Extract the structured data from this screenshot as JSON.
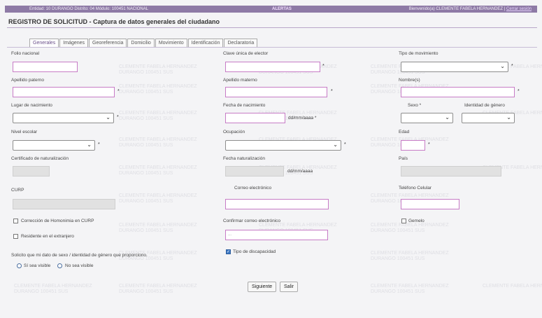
{
  "header": {
    "entity": "Entidad: 10 DURANGO Distrito: 04 Módulo: 100451 NACIONAL",
    "alerts": "ALERTAS",
    "welcome": "Bienvenido(a) CLEMENTE FABELA HERNANDEZ |",
    "logout": "Cerrar sesión"
  },
  "page": {
    "title": "REGISTRO DE SOLICITUD - Captura de datos generales del ciudadano"
  },
  "tabs": [
    {
      "label": "Generales"
    },
    {
      "label": "Imágenes"
    },
    {
      "label": "Georeferencia"
    },
    {
      "label": "Domicilio"
    },
    {
      "label": "Movimiento"
    },
    {
      "label": "Identificación"
    },
    {
      "label": "Declaratoria"
    }
  ],
  "form": {
    "folio": {
      "label": "Folio nacional",
      "value": ""
    },
    "clave_elector": {
      "label": "Clave única de elector",
      "value": ""
    },
    "tipo_movimiento": {
      "label": "Tipo de movimiento",
      "selected": ""
    },
    "apellido_paterno": {
      "label": "Apellido paterno",
      "value": ""
    },
    "apellido_materno": {
      "label": "Apellido materno",
      "value": ""
    },
    "nombres": {
      "label": "Nombre(s)",
      "value": ""
    },
    "lugar_nacimiento": {
      "label": "Lugar de nacimiento",
      "selected": ""
    },
    "fecha_nacimiento": {
      "label": "Fecha de nacimiento",
      "hint": "dd/mm/aaaa *"
    },
    "sexo": {
      "label": "Sexo *",
      "selected": ""
    },
    "identidad_genero": {
      "label": "Identidad de género",
      "selected": ""
    },
    "nivel_escolar": {
      "label": "Nivel escolar",
      "selected": ""
    },
    "ocupacion": {
      "label": "Ocupación",
      "selected": ""
    },
    "edad": {
      "label": "Edad",
      "value": ""
    },
    "certificado": {
      "label": "Certificado de naturalización"
    },
    "fecha_naturalizacion": {
      "label": "Fecha naturalización",
      "hint": "dd/mm/aaaa"
    },
    "pais": {
      "label": "País"
    },
    "curp": {
      "label": "CURP"
    },
    "correo": {
      "label": "Correo electrónico",
      "value": ""
    },
    "telefono": {
      "label": "Teléfono Celular",
      "value": ""
    },
    "homonimia": {
      "label": "Corrección de Homonimia en CURP",
      "checked": false
    },
    "confirmar_correo": {
      "label": "Confirmar correo electrónico",
      "placeholder": "..."
    },
    "gemelo": {
      "label": "Gemelo",
      "checked": false
    },
    "residente": {
      "label": "Residente en el extranjero",
      "checked": false
    },
    "discapacidad": {
      "label": "Tipo de discapacidad",
      "checked": true
    },
    "solicito": {
      "label": "Solicito que mi dato de sexo / identidad de género que proporciono.",
      "option_visible": "Sí sea visible",
      "option_no_visible": "No sea visible"
    },
    "required_mark": "*"
  },
  "actions": {
    "next": "Siguiente",
    "exit": "Salir"
  },
  "watermark": {
    "line1": "CLEMENTE FABELA HERNANDEZ",
    "line2": "DURANGO 100451 SUS"
  },
  "colors": {
    "header_bg": "#8e7aa6",
    "input_border": "#c77cc6",
    "accent": "#6a4f8a"
  }
}
